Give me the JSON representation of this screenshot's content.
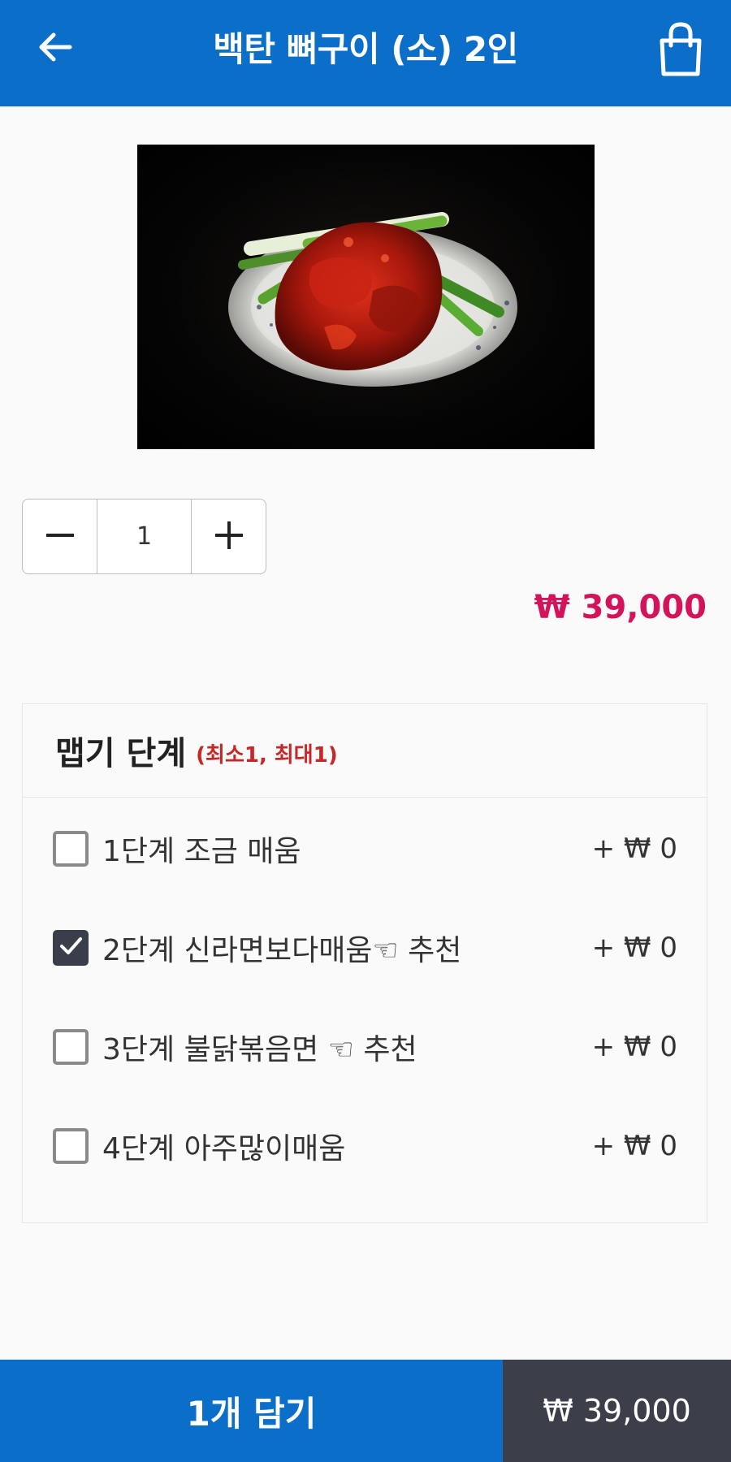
{
  "header": {
    "title": "백탄 뼈구이 (소) 2인",
    "back_icon": "arrow-left-icon",
    "cart_icon": "shopping-bag-icon"
  },
  "product": {
    "image": "spicy-grilled-pork-bones-photo",
    "quantity": "1",
    "price": "₩ 39,000"
  },
  "options": {
    "title": "맵기 단계",
    "constraint": "(최소1, 최대1)",
    "items": [
      {
        "label": "1단계 조금 매움",
        "price": "+ ₩ 0",
        "checked": false
      },
      {
        "label": "2단계 신라면보다매움☜ 추천",
        "price": "+ ₩ 0",
        "checked": true
      },
      {
        "label": "3단계 불닭볶음면 ☜ 추천",
        "price": "+ ₩ 0",
        "checked": false
      },
      {
        "label": "4단계 아주많이매움",
        "price": "+ ₩ 0",
        "checked": false
      }
    ]
  },
  "footer": {
    "add_label": "1개 담기",
    "total": "₩ 39,000"
  },
  "colors": {
    "primary": "#0b6fca",
    "price": "#d4145a",
    "constraint": "#c62828",
    "total_bg": "#3c3f4a"
  }
}
